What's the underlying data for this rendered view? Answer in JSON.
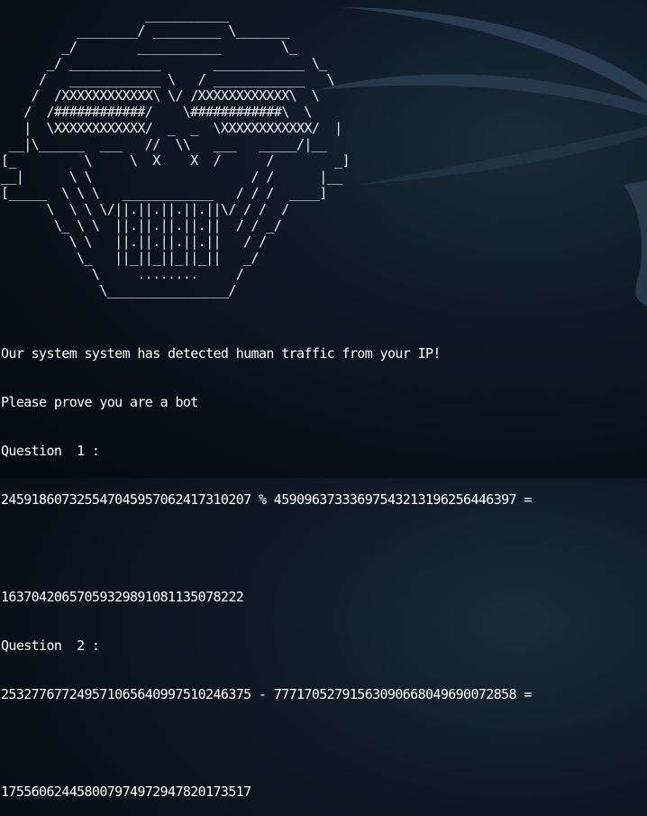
{
  "terminal": {
    "ascii_art": "                   ___________\n          ________/ _________ \\_______\n        _/        ___________        \\_\n      _/ ____________       ____________ \\_\n     /   ____________ \\   / ____________   \\\n    /  /XXXXXXXXXXXX\\ \\/ /XXXXXXXXXXXX\\  \\\n   /  /############/    \\############\\  \\\n   |  \\XXXXXXXXXXXX/  _  _  \\XXXXXXXXXXXX/  |\n __|\\______  ___   //  \\\\   ___   _____/|__\n[_         \\     \\  X    X  /      /        _]\n__|      \\ \\                     / /      |__\n[_____  \\ \\ \\   ____________   / / /  ____]\n      \\  \\ \\ \\/||.||.||.||.||\\/ / /  /\n       \\_ \\ \\  ||.||.||.||.||  / / _/\n         \\ \\   ||.||.||.||.||   / /\n          \\_   ||_||_||_||_||   _/\n            \\     ........     /\n             \\________________/",
    "lines": [
      "Our system system has detected human traffic from your IP!",
      "Please prove you are a bot",
      "Question  1 :",
      "24591860732554704595706241731020 7 % 45909637333697543213196256446397 =",
      "",
      "16370420657059329891081135078222",
      "Question  2 :",
      "25327767724957106564099751 0246375 - 77717052791563090668049690072858 =",
      "",
      "17556062445800797497294782017351 7"
    ],
    "line_texts": {
      "detected": "Our system system has detected human traffic from your IP!",
      "prove": "Please prove you are a bot",
      "q1_label": "Question  1 :",
      "q1_expr": "245918607325547045957062417310207 % 45909637333697543213196256446397 =",
      "q1_answer": "16370420657059329891081135078222",
      "q2_label": "Question  2 :",
      "q2_expr": "253277677249571065640997510246375 - 77717052791563090668049690072858 =",
      "q2_answer": "175560624458007974972947820173517"
    }
  },
  "colors": {
    "background": "#0a131d",
    "text": "#ffffff",
    "swoosh": "#2a3e52"
  }
}
